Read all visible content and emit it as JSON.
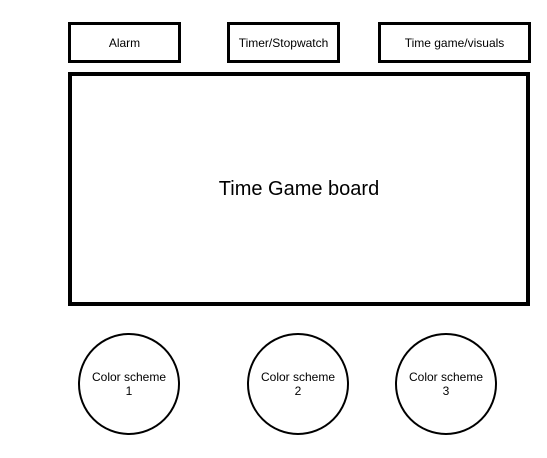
{
  "nav": {
    "alarm_label": "Alarm",
    "timer_label": "Timer/Stopwatch",
    "game_label": "Time game/visuals"
  },
  "board": {
    "title": "Time Game board"
  },
  "color_schemes": [
    {
      "label": "Color scheme",
      "number": "1"
    },
    {
      "label": "Color scheme",
      "number": "2"
    },
    {
      "label": "Color scheme",
      "number": "3"
    }
  ]
}
